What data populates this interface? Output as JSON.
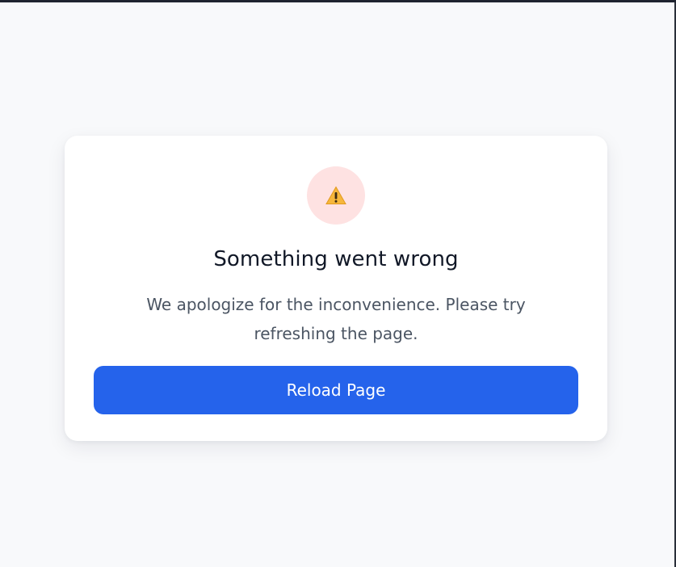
{
  "error_card": {
    "icon": "warning-icon",
    "title": "Something went wrong",
    "message": "We apologize for the inconvenience. Please try refreshing the page.",
    "button_label": "Reload Page"
  },
  "colors": {
    "page_background": "#f8f9fb",
    "card_background": "#ffffff",
    "icon_background": "#fee2e2",
    "warning_accent": "#f6b73c",
    "title_text": "#111827",
    "message_text": "#4b5563",
    "button_background": "#2563eb",
    "button_text": "#ffffff"
  }
}
